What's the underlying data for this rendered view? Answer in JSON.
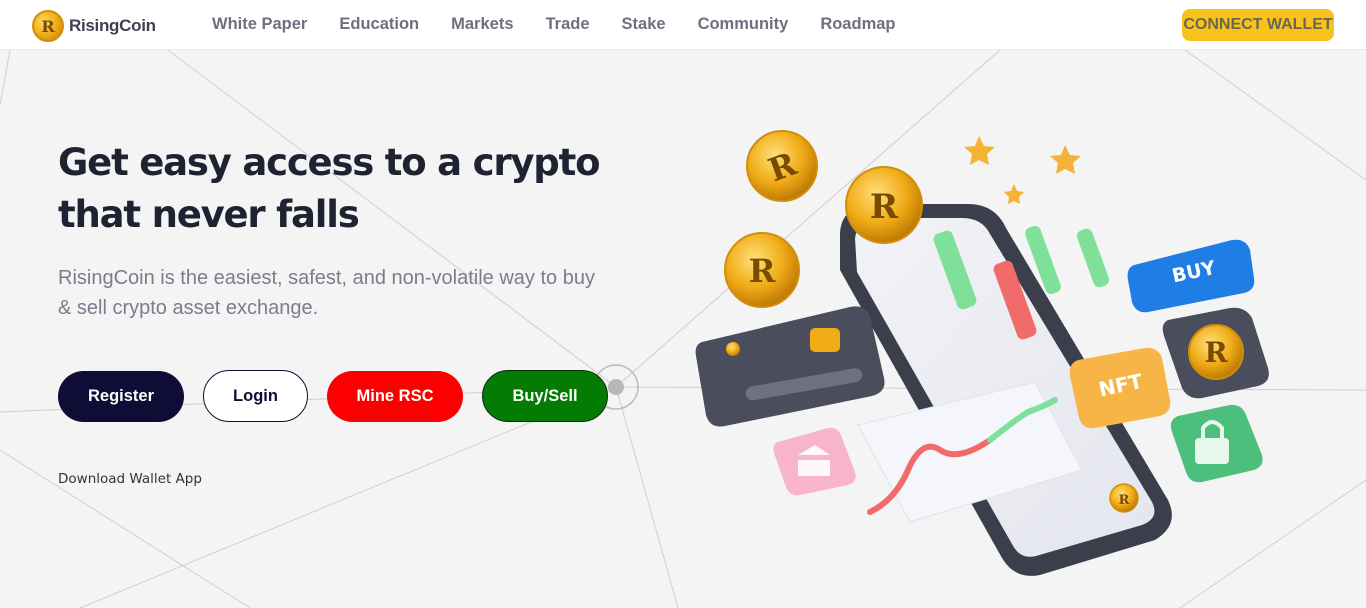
{
  "brand": {
    "name": "RisingCoin",
    "logo_letter": "R"
  },
  "nav": {
    "items": [
      "White Paper",
      "Education",
      "Markets",
      "Trade",
      "Stake",
      "Community",
      "Roadmap"
    ],
    "connect_label": "CONNECT WALLET"
  },
  "hero": {
    "title": "Get easy access to a crypto that never falls",
    "subtitle": "RisingCoin is the easiest, safest, and non-volatile way to buy & sell crypto asset exchange.",
    "buttons": {
      "register": "Register",
      "login": "Login",
      "mine": "Mine RSC",
      "buysell": "Buy/Sell"
    },
    "download_label": "Download Wallet App"
  },
  "illustration": {
    "buy_tag": "BUY",
    "nft_tag": "NFT",
    "coin_letter": "R"
  },
  "colors": {
    "accent": "#f7c21b",
    "register": "#0f0c35",
    "mine": "#fb0000",
    "buysell": "#047c04",
    "buy_tag": "#1f7ee6",
    "candle_green": "#7fe09a",
    "candle_red": "#f26b6b"
  }
}
